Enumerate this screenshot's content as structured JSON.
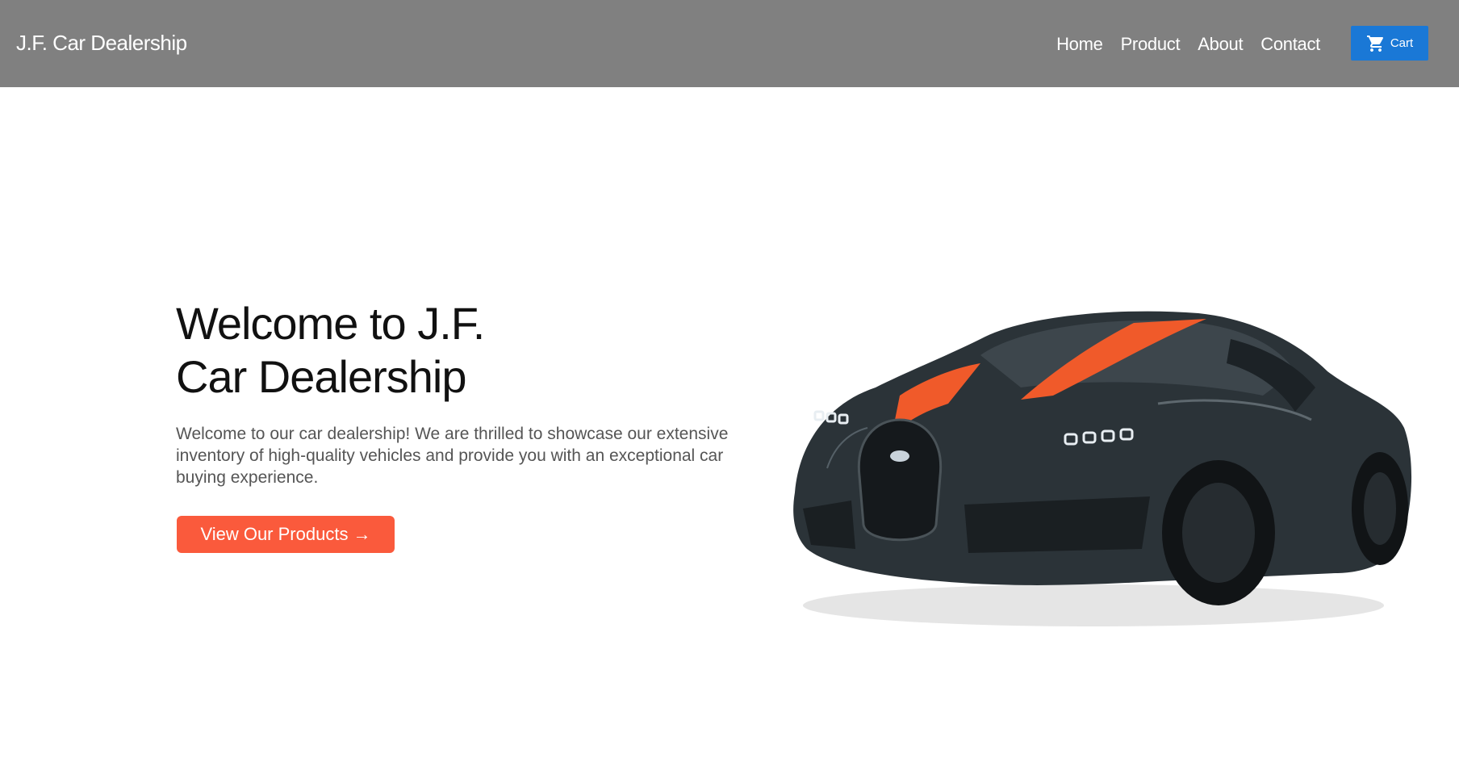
{
  "nav": {
    "brand": "J.F. Car Dealership",
    "links": [
      "Home",
      "Product",
      "About",
      "Contact"
    ],
    "cart_label": "Cart",
    "cart_icon": "cart-icon",
    "cart_color": "#1a78d6"
  },
  "hero": {
    "title_line1": "Welcome to J.F.",
    "title_line2": "Car Dealership",
    "description": "Welcome to our car dealership! We are thrilled to showcase our extensive inventory of high-quality vehicles and provide you with an exceptional car buying experience.",
    "cta_label": "View Our Products →",
    "cta_color": "#fa5a3c"
  },
  "colors": {
    "navbar": "#808080",
    "car_body": "#2b3338",
    "car_stripe": "#f05a2a"
  }
}
